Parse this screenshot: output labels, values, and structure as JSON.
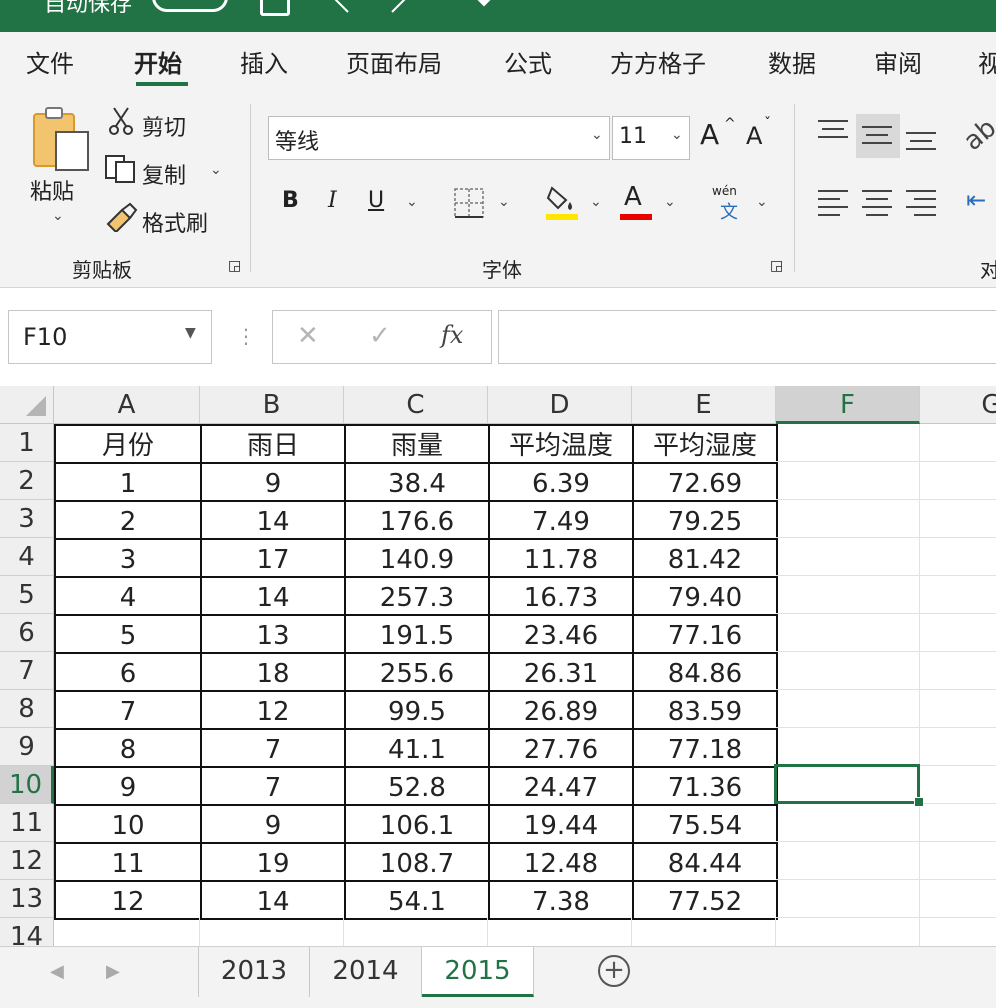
{
  "colors": {
    "accent": "#217346",
    "ribbon_bg": "#f3f3f3",
    "highlight_yellow": "#ffe600",
    "font_red": "#e60000"
  },
  "titlebar": {
    "text": "自动保存"
  },
  "menu": {
    "items": [
      "文件",
      "开始",
      "插入",
      "页面布局",
      "公式",
      "方方格子",
      "数据",
      "审阅",
      "视"
    ],
    "active": "开始"
  },
  "ribbon": {
    "clipboard": {
      "paste": "粘贴",
      "cut": "剪切",
      "copy": "复制",
      "format_painter": "格式刷",
      "group_label": "剪贴板"
    },
    "font": {
      "name": "等线",
      "size": "11",
      "bold": "B",
      "italic": "I",
      "underline": "U",
      "grow": "A",
      "shrink": "A",
      "font_color_icon": "A",
      "phonetic_top": "wén",
      "phonetic_bottom": "文",
      "group_label": "字体"
    },
    "alignment": {
      "group_label": "对"
    }
  },
  "formula_bar": {
    "name_box": "F10",
    "cancel": "✕",
    "enter": "✓",
    "fx": "fx",
    "value": "",
    "more": "⋮"
  },
  "grid": {
    "columns": [
      "A",
      "B",
      "C",
      "D",
      "E",
      "F",
      "G"
    ],
    "rows": [
      "1",
      "2",
      "3",
      "4",
      "5",
      "6",
      "7",
      "8",
      "9",
      "10",
      "11",
      "12",
      "13",
      "14"
    ],
    "active_cell": "F10",
    "headers": [
      "月份",
      "雨日",
      "雨量",
      "平均温度",
      "平均湿度"
    ],
    "data": [
      [
        "1",
        "9",
        "38.4",
        "6.39",
        "72.69"
      ],
      [
        "2",
        "14",
        "176.6",
        "7.49",
        "79.25"
      ],
      [
        "3",
        "17",
        "140.9",
        "11.78",
        "81.42"
      ],
      [
        "4",
        "14",
        "257.3",
        "16.73",
        "79.40"
      ],
      [
        "5",
        "13",
        "191.5",
        "23.46",
        "77.16"
      ],
      [
        "6",
        "18",
        "255.6",
        "26.31",
        "84.86"
      ],
      [
        "7",
        "12",
        "99.5",
        "26.89",
        "83.59"
      ],
      [
        "8",
        "7",
        "41.1",
        "27.76",
        "77.18"
      ],
      [
        "9",
        "7",
        "52.8",
        "24.47",
        "71.36"
      ],
      [
        "10",
        "9",
        "106.1",
        "19.44",
        "75.54"
      ],
      [
        "11",
        "19",
        "108.7",
        "12.48",
        "84.44"
      ],
      [
        "12",
        "14",
        "54.1",
        "7.38",
        "77.52"
      ]
    ]
  },
  "sheets": {
    "tabs": [
      "2013",
      "2014",
      "2015"
    ],
    "active": "2015",
    "add": "+"
  }
}
